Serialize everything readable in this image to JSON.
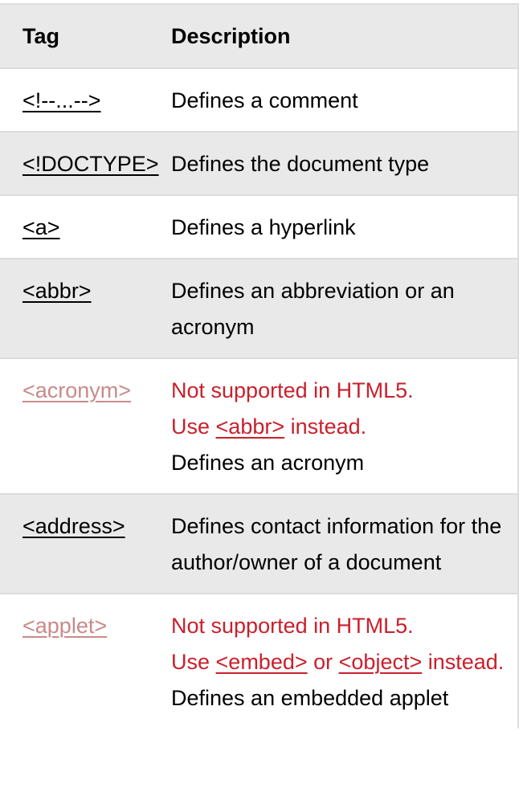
{
  "header": {
    "tag": "Tag",
    "description": "Description"
  },
  "rows": [
    {
      "tag": "<!--...-->",
      "description": "Defines a comment"
    },
    {
      "tag": "<!DOCTYPE>",
      "description": "Defines the document type"
    },
    {
      "tag": "<a>",
      "description": "Defines a hyperlink"
    },
    {
      "tag": "<abbr>",
      "description": "Defines an abbreviation or an acronym"
    },
    {
      "tag": "<acronym>",
      "warn_line1": "Not supported in HTML5.",
      "warn_use": "Use ",
      "alt1": "<abbr>",
      "warn_instead": " instead.",
      "description": "Defines an acronym"
    },
    {
      "tag": "<address>",
      "description": "Defines contact information for the author/owner of a document"
    },
    {
      "tag": "<applet>",
      "warn_line1": "Not supported in HTML5.",
      "warn_use": "Use ",
      "alt1": "<embed>",
      "warn_or": " or ",
      "alt2": "<object>",
      "warn_instead": " instead.",
      "description": "Defines an embedded applet"
    }
  ],
  "colors": {
    "header_bg": "#e9e9e9",
    "border": "#dcdcdc",
    "deprecated_link": "#c98a8a",
    "warning_text": "#c9202c"
  }
}
